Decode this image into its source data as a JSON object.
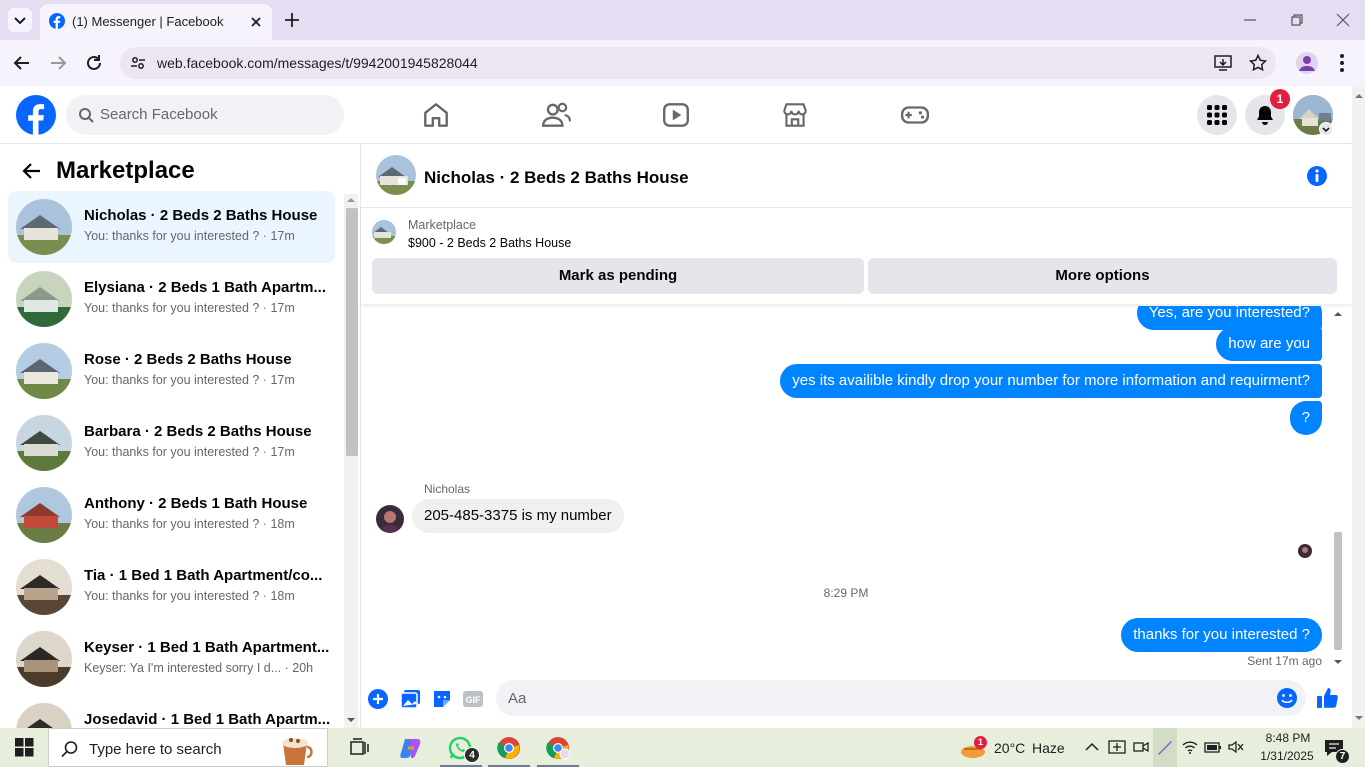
{
  "browser": {
    "tab_title": "(1) Messenger | Facebook",
    "url": "web.facebook.com/messages/t/9942001945828044"
  },
  "header": {
    "search_placeholder": "Search Facebook",
    "notification_count": "1"
  },
  "sidebar": {
    "title": "Marketplace",
    "conversations": [
      {
        "name": "Nicholas · 2 Beds 2 Baths House",
        "preview": "You: thanks for you interested ? · 17m",
        "active": true
      },
      {
        "name": "Elysiana · 2 Beds 1 Bath Apartm...",
        "preview": "You: thanks for you interested ? · 17m"
      },
      {
        "name": "Rose · 2 Beds 2 Baths House",
        "preview": "You: thanks for you interested ? · 17m"
      },
      {
        "name": "Barbara · 2 Beds 2 Baths House",
        "preview": "You: thanks for you interested ? · 17m"
      },
      {
        "name": "Anthony · 2 Beds 1 Bath House",
        "preview": "You: thanks for you interested ? · 18m"
      },
      {
        "name": "Tia · 1 Bed 1 Bath Apartment/co...",
        "preview": "You: thanks for you interested ? · 18m"
      },
      {
        "name": "Keyser · 1 Bed 1 Bath Apartment...",
        "preview": "Keyser: Ya I'm interested sorry I d... · 20h"
      },
      {
        "name": "Josedavid · 1 Bed 1 Bath Apartm...",
        "preview": ""
      }
    ]
  },
  "chat": {
    "title": "Nicholas · 2 Beds 2 Baths House",
    "listing_source": "Marketplace",
    "listing_price": "$900 - 2 Beds 2 Baths House",
    "mark_pending_label": "Mark as pending",
    "more_options_label": "More options",
    "messages_out_top": [
      "Yes, are you interested?",
      "how are you",
      "yes its availible kindly drop your number for more information and requirment?",
      "?"
    ],
    "sender_name": "Nicholas",
    "message_in": "205-485-3375 is my number",
    "timestamp": "8:29 PM",
    "message_out_last": "thanks for you interested ?",
    "sent_status": "Sent 17m ago",
    "input_placeholder": "Aa"
  },
  "taskbar": {
    "search_placeholder": "Type here to search",
    "weather_temp": "20°C",
    "weather_desc": "Haze",
    "weather_badge": "1",
    "time": "8:48 PM",
    "date": "1/31/2025",
    "whatsapp_badge": "4",
    "notification_count": "7"
  },
  "colors": {
    "fb_blue": "#0866ff",
    "messenger_blue": "#0084ff",
    "tabbar": "#e6ddf2",
    "taskbar": "#e8eedc"
  }
}
